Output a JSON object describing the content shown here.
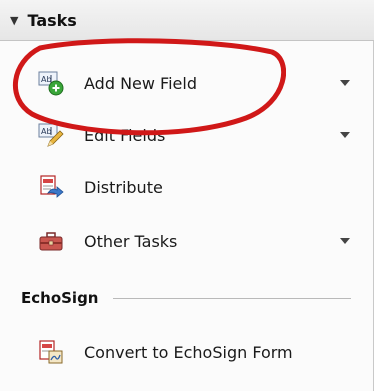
{
  "tasks": {
    "title": "Tasks",
    "items": [
      {
        "label": "Add New Field",
        "icon": "add-field-icon",
        "has_menu": true
      },
      {
        "label": "Edit Fields",
        "icon": "edit-fields-icon",
        "has_menu": true
      },
      {
        "label": "Distribute",
        "icon": "distribute-icon",
        "has_menu": false
      },
      {
        "label": "Other Tasks",
        "icon": "toolbox-icon",
        "has_menu": true
      }
    ]
  },
  "echosign": {
    "title": "EchoSign",
    "items": [
      {
        "label": "Convert to EchoSign Form",
        "icon": "convert-form-icon"
      }
    ]
  },
  "colors": {
    "highlight_ring": "#d01818",
    "header_bg": "#ececec",
    "panel_bg": "#fbfbfb"
  }
}
